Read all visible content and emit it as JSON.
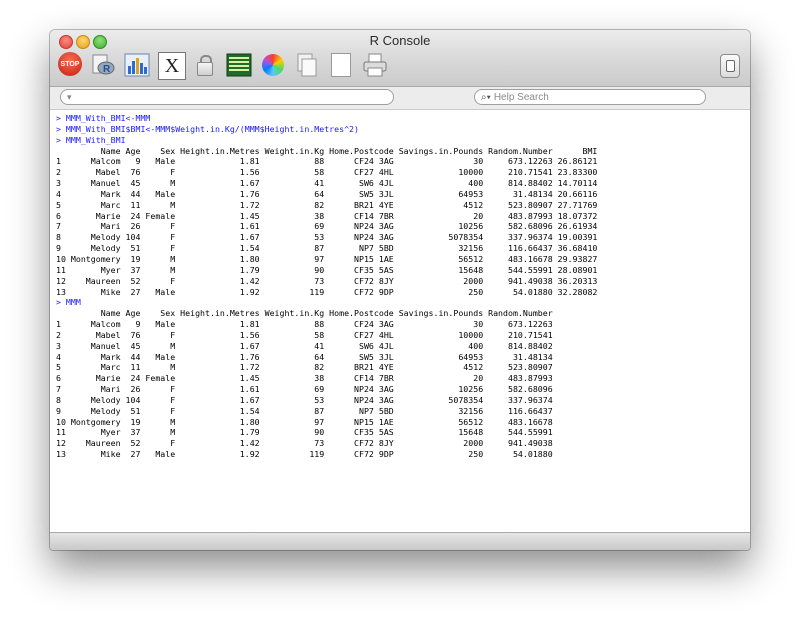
{
  "window": {
    "title": "R Console"
  },
  "toolbar": {
    "stop_label": "STOP",
    "icons": [
      "stop-icon",
      "source-script-icon",
      "quartz-chart-icon",
      "x11-icon",
      "lock-icon",
      "set-working-dir-icon",
      "color-picker-icon",
      "copy-icon",
      "new-document-icon",
      "print-icon",
      "toggle-drawer-icon"
    ]
  },
  "search": {
    "path_value": "",
    "help_placeholder": "Help Search"
  },
  "console": {
    "lines": [
      {
        "type": "cmd",
        "text": "> MMM_With_BMI<-MMM"
      },
      {
        "type": "cmd",
        "text": "> MMM_With_BMI$BMI<-MMM$Weight.in.Kg/(MMM$Height.in.Metres^2)"
      },
      {
        "type": "cmd",
        "text": "> MMM_With_BMI"
      },
      {
        "type": "out",
        "text": "         Name Age    Sex Height.in.Metres Weight.in.Kg Home.Postcode Savings.in.Pounds Random.Number      BMI"
      },
      {
        "type": "out",
        "text": "1      Malcom   9   Male             1.81           88      CF24 3AG                30     673.12263 26.86121"
      },
      {
        "type": "out",
        "text": "2       Mabel  76      F             1.56           58      CF27 4HL             10000     210.71541 23.83300"
      },
      {
        "type": "out",
        "text": "3      Manuel  45      M             1.67           41       SW6 4JL               400     814.88402 14.70114"
      },
      {
        "type": "out",
        "text": "4        Mark  44   Male             1.76           64       SW5 3JL             64953      31.48134 20.66116"
      },
      {
        "type": "out",
        "text": "5        Marc  11      M             1.72           82      BR21 4YE              4512     523.80907 27.71769"
      },
      {
        "type": "out",
        "text": "6       Marie  24 Female             1.45           38      CF14 7BR                20     483.87993 18.07372"
      },
      {
        "type": "out",
        "text": "7        Mari  26      F             1.61           69      NP24 3AG             10256     582.68096 26.61934"
      },
      {
        "type": "out",
        "text": "8      Melody 104      F             1.67           53      NP24 3AG           5078354     337.96374 19.00391"
      },
      {
        "type": "out",
        "text": "9      Melody  51      F             1.54           87       NP7 5BD             32156     116.66437 36.68410"
      },
      {
        "type": "out",
        "text": "10 Montgomery  19      M             1.80           97      NP15 1AE             56512     483.16678 29.93827"
      },
      {
        "type": "out",
        "text": "11       Myer  37      M             1.79           90      CF35 5AS             15648     544.55991 28.08901"
      },
      {
        "type": "out",
        "text": "12    Maureen  52      F             1.42           73      CF72 8JY              2000     941.49038 36.20313"
      },
      {
        "type": "out",
        "text": "13       Mike  27   Male             1.92          119      CF72 9DP               250      54.01880 32.28082"
      },
      {
        "type": "cmd",
        "text": "> MMM"
      },
      {
        "type": "out",
        "text": "         Name Age    Sex Height.in.Metres Weight.in.Kg Home.Postcode Savings.in.Pounds Random.Number"
      },
      {
        "type": "out",
        "text": "1      Malcom   9   Male             1.81           88      CF24 3AG                30     673.12263"
      },
      {
        "type": "out",
        "text": "2       Mabel  76      F             1.56           58      CF27 4HL             10000     210.71541"
      },
      {
        "type": "out",
        "text": "3      Manuel  45      M             1.67           41       SW6 4JL               400     814.88402"
      },
      {
        "type": "out",
        "text": "4        Mark  44   Male             1.76           64       SW5 3JL             64953      31.48134"
      },
      {
        "type": "out",
        "text": "5        Marc  11      M             1.72           82      BR21 4YE              4512     523.80907"
      },
      {
        "type": "out",
        "text": "6       Marie  24 Female             1.45           38      CF14 7BR                20     483.87993"
      },
      {
        "type": "out",
        "text": "7        Mari  26      F             1.61           69      NP24 3AG             10256     582.68096"
      },
      {
        "type": "out",
        "text": "8      Melody 104      F             1.67           53      NP24 3AG           5078354     337.96374"
      },
      {
        "type": "out",
        "text": "9      Melody  51      F             1.54           87       NP7 5BD             32156     116.66437"
      },
      {
        "type": "out",
        "text": "10 Montgomery  19      M             1.80           97      NP15 1AE             56512     483.16678"
      },
      {
        "type": "out",
        "text": "11       Myer  37      M             1.79           90      CF35 5AS             15648     544.55991"
      },
      {
        "type": "out",
        "text": "12    Maureen  52      F             1.42           73      CF72 8JY              2000     941.49038"
      },
      {
        "type": "out",
        "text": "13       Mike  27   Male             1.92          119      CF72 9DP               250      54.01880"
      }
    ]
  }
}
